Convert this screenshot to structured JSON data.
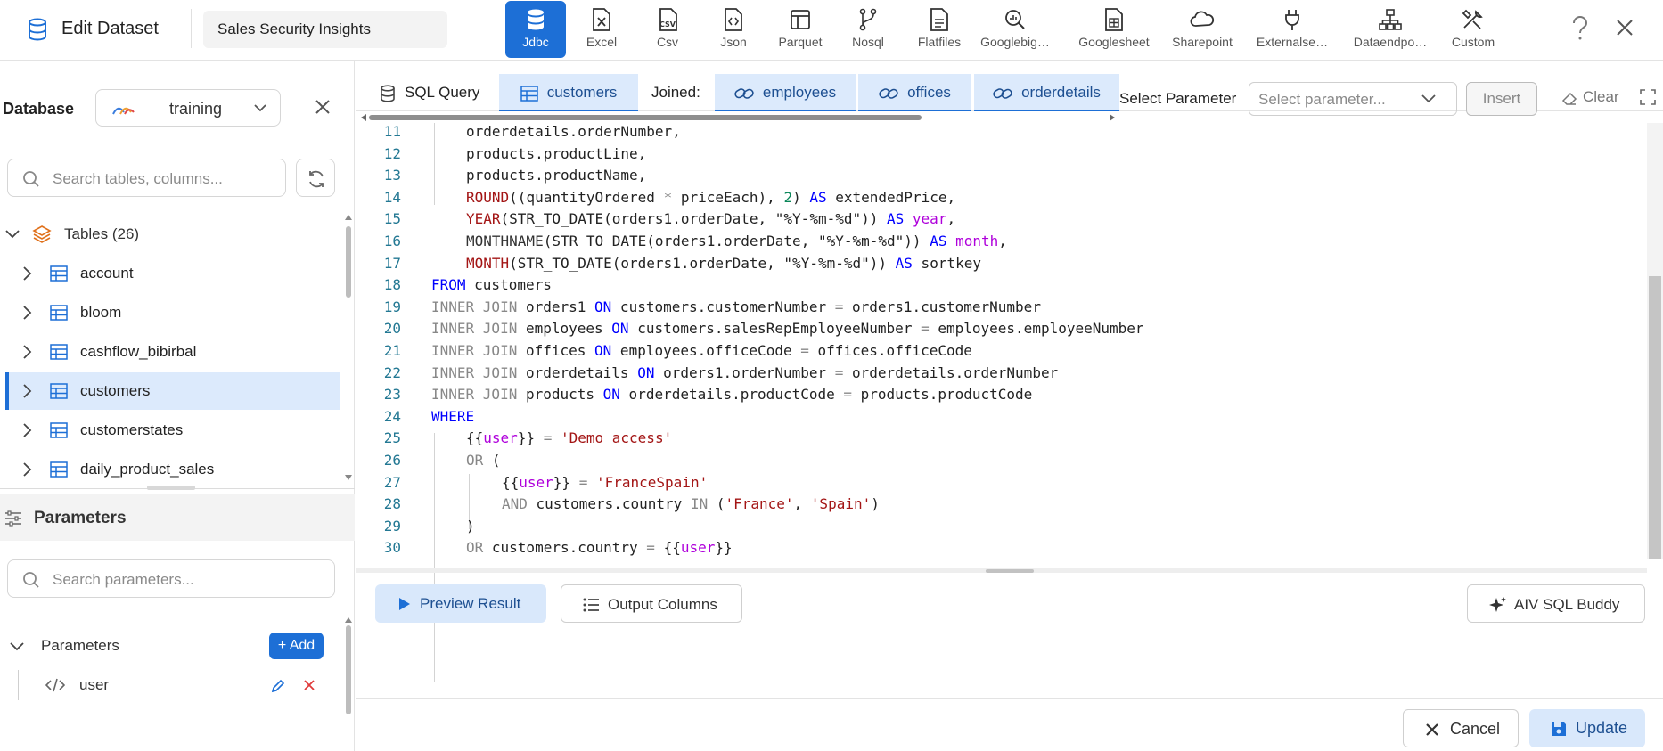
{
  "header": {
    "title": "Edit Dataset",
    "dataset_name": "Sales Security Insights",
    "connectors": [
      {
        "label": "Jdbc",
        "icon": "database-icon",
        "active": true
      },
      {
        "label": "Excel",
        "icon": "excel-file-icon"
      },
      {
        "label": "Csv",
        "icon": "csv-file-icon"
      },
      {
        "label": "Json",
        "icon": "json-file-icon"
      },
      {
        "label": "Parquet",
        "icon": "parquet-icon"
      },
      {
        "label": "Nosql",
        "icon": "nosql-icon"
      },
      {
        "label": "Flatfiles",
        "icon": "flatfile-icon"
      },
      {
        "label": "Googlebig…",
        "icon": "googlebigquery-icon"
      },
      {
        "label": "Googlesheet",
        "icon": "googlesheet-icon"
      },
      {
        "label": "Sharepoint",
        "icon": "cloud-icon"
      },
      {
        "label": "Externalse…",
        "icon": "plug-icon"
      },
      {
        "label": "Dataendpo…",
        "icon": "network-icon"
      },
      {
        "label": "Custom",
        "icon": "tools-icon"
      }
    ]
  },
  "colors": {
    "accent": "#1d6fd6",
    "accent_light": "#dceafc",
    "keyword": "#0000ff",
    "string": "#a31515",
    "variable": "#af00db",
    "line_number": "#237893"
  },
  "sidebar": {
    "database_label": "Database",
    "database_value": "training",
    "table_search_placeholder": "Search tables, columns...",
    "tables_header": "Tables (26)",
    "tables": [
      {
        "name": "account"
      },
      {
        "name": "bloom"
      },
      {
        "name": "cashflow_bibirbal"
      },
      {
        "name": "customers",
        "selected": true
      },
      {
        "name": "customerstates"
      },
      {
        "name": "daily_product_sales"
      }
    ],
    "parameters_title": "Parameters",
    "param_search_placeholder": "Search parameters...",
    "param_group_label": "Parameters",
    "add_label": "+ Add",
    "params": [
      {
        "name": "user"
      }
    ]
  },
  "tabs": {
    "sql_query": "SQL Query",
    "base": "customers",
    "joined_label": "Joined:",
    "joined": [
      "employees",
      "offices",
      "orderdetails"
    ],
    "select_param_label": "Select Parameter",
    "select_param_placeholder": "Select parameter...",
    "insert_label": "Insert",
    "clear_label": "Clear"
  },
  "editor": {
    "line_numbers": [
      "11",
      "12",
      "13",
      "14",
      "15",
      "16",
      "17",
      "18",
      "19",
      "20",
      "21",
      "22",
      "23",
      "24",
      "25",
      "26",
      "27",
      "28",
      "29",
      "30"
    ],
    "l11": "orderdetails.orderNumber,",
    "l12": "products.productLine,",
    "l13": "products.productName,",
    "l14": {
      "fn": "ROUND",
      "a": "((quantityOrdered ",
      "op": "*",
      "b": " priceEach), ",
      "n": "2",
      "c": ") ",
      "kw": "AS",
      "d": " extendedPrice,"
    },
    "l15": {
      "fn": "YEAR",
      "a": "(STR_TO_DATE(orders1.orderDate, \"%Y-%m-%d\")) ",
      "kw": "AS",
      "v": " year",
      "e": ","
    },
    "l16": {
      "fn": "MONTHNAME",
      "a": "(STR_TO_DATE(orders1.orderDate, \"%Y-%m-%d\")) ",
      "kw": "AS",
      "v": " month",
      "e": ","
    },
    "l17": {
      "fn": "MONTH",
      "a": "(STR_TO_DATE(orders1.orderDate, \"%Y-%m-%d\")) ",
      "kw": "AS",
      "d": " sortkey"
    },
    "l18": {
      "kw": "FROM",
      "d": " customers"
    },
    "l19": {
      "kw": "INNER JOIN",
      "a": " orders1 ",
      "on": "ON",
      "b": " customers.customerNumber ",
      "op": "=",
      "c": " orders1.customerNumber"
    },
    "l20": {
      "kw": "INNER JOIN",
      "a": " employees ",
      "on": "ON",
      "b": " customers.salesRepEmployeeNumber ",
      "op": "=",
      "c": " employees.employeeNumber"
    },
    "l21": {
      "kw": "INNER JOIN",
      "a": " offices ",
      "on": "ON",
      "b": " employees.officeCode ",
      "op": "=",
      "c": " offices.officeCode"
    },
    "l22": {
      "kw": "INNER JOIN",
      "a": " orderdetails ",
      "on": "ON",
      "b": " orders1.orderNumber ",
      "op": "=",
      "c": " orderdetails.orderNumber"
    },
    "l23": {
      "kw": "INNER JOIN",
      "a": " products ",
      "on": "ON",
      "b": " orderdetails.productCode ",
      "op": "=",
      "c": " products.productCode"
    },
    "l24": "WHERE",
    "l25": {
      "o": "{{",
      "v": "user",
      "c": "}} ",
      "op": "=",
      "s": " 'Demo access'"
    },
    "l26": {
      "kw": "OR",
      "a": " ("
    },
    "l27": {
      "o": "{{",
      "v": "user",
      "c": "}} ",
      "op": "=",
      "s": " 'FranceSpain'"
    },
    "l28": {
      "kw": "AND",
      "a": " customers.country ",
      "in": "IN",
      "b": " (",
      "s1": "'France'",
      "cm": ", ",
      "s2": "'Spain'",
      "e": ")"
    },
    "l29": ")",
    "l30": {
      "kw": "OR",
      "a": " customers.country ",
      "op": "=",
      "b": " {{",
      "v": "user",
      "c": "}}"
    }
  },
  "actions": {
    "preview_label": "Preview Result",
    "output_columns_label": "Output Columns",
    "sql_buddy_label": "AIV SQL Buddy",
    "cancel_label": "Cancel",
    "update_label": "Update"
  }
}
